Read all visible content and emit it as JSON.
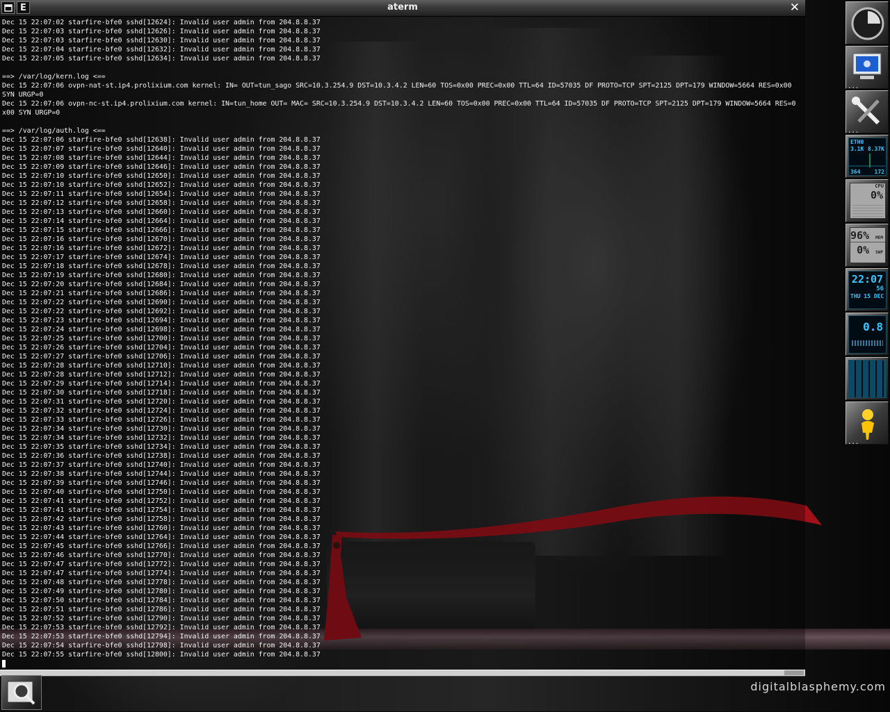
{
  "window": {
    "title": "aterm",
    "menu_button_label": "E",
    "close_symbol": "✕"
  },
  "terminal_lines": [
    "Dec 15 22:07:02 starfire-bfe0 sshd[12624]: Invalid user admin from 204.8.8.37",
    "Dec 15 22:07:03 starfire-bfe0 sshd[12626]: Invalid user admin from 204.8.8.37",
    "Dec 15 22:07:03 starfire-bfe0 sshd[12630]: Invalid user admin from 204.8.8.37",
    "Dec 15 22:07:04 starfire-bfe0 sshd[12632]: Invalid user admin from 204.8.8.37",
    "Dec 15 22:07:05 starfire-bfe0 sshd[12634]: Invalid user admin from 204.8.8.37",
    "",
    "==> /var/log/kern.log <==",
    "Dec 15 22:07:06 ovpn-nat-st.ip4.prolixium.com kernel: IN= OUT=tun_sago SRC=10.3.254.9 DST=10.3.4.2 LEN=60 TOS=0x00 PREC=0x00 TTL=64 ID=57035 DF PROTO=TCP SPT=2125 DPT=179 WINDOW=5664 RES=0x00",
    "SYN URGP=0",
    "Dec 15 22:07:06 ovpn-nc-st.ip4.prolixium.com kernel: IN=tun_home OUT= MAC= SRC=10.3.254.9 DST=10.3.4.2 LEN=60 TOS=0x00 PREC=0x00 TTL=64 ID=57035 DF PROTO=TCP SPT=2125 DPT=179 WINDOW=5664 RES=0",
    "x00 SYN URGP=0",
    "",
    "==> /var/log/auth.log <==",
    "Dec 15 22:07:06 starfire-bfe0 sshd[12638]: Invalid user admin from 204.8.8.37",
    "Dec 15 22:07:07 starfire-bfe0 sshd[12640]: Invalid user admin from 204.8.8.37",
    "Dec 15 22:07:08 starfire-bfe0 sshd[12644]: Invalid user admin from 204.8.8.37",
    "Dec 15 22:07:09 starfire-bfe0 sshd[12646]: Invalid user admin from 204.8.8.37",
    "Dec 15 22:07:10 starfire-bfe0 sshd[12650]: Invalid user admin from 204.8.8.37",
    "Dec 15 22:07:10 starfire-bfe0 sshd[12652]: Invalid user admin from 204.8.8.37",
    "Dec 15 22:07:11 starfire-bfe0 sshd[12654]: Invalid user admin from 204.8.8.37",
    "Dec 15 22:07:12 starfire-bfe0 sshd[12658]: Invalid user admin from 204.8.8.37",
    "Dec 15 22:07:13 starfire-bfe0 sshd[12660]: Invalid user admin from 204.8.8.37",
    "Dec 15 22:07:14 starfire-bfe0 sshd[12664]: Invalid user admin from 204.8.8.37",
    "Dec 15 22:07:15 starfire-bfe0 sshd[12666]: Invalid user admin from 204.8.8.37",
    "Dec 15 22:07:16 starfire-bfe0 sshd[12670]: Invalid user admin from 204.8.8.37",
    "Dec 15 22:07:16 starfire-bfe0 sshd[12672]: Invalid user admin from 204.8.8.37",
    "Dec 15 22:07:17 starfire-bfe0 sshd[12674]: Invalid user admin from 204.8.8.37",
    "Dec 15 22:07:18 starfire-bfe0 sshd[12678]: Invalid user admin from 204.8.8.37",
    "Dec 15 22:07:19 starfire-bfe0 sshd[12680]: Invalid user admin from 204.8.8.37",
    "Dec 15 22:07:20 starfire-bfe0 sshd[12684]: Invalid user admin from 204.8.8.37",
    "Dec 15 22:07:21 starfire-bfe0 sshd[12686]: Invalid user admin from 204.8.8.37",
    "Dec 15 22:07:22 starfire-bfe0 sshd[12690]: Invalid user admin from 204.8.8.37",
    "Dec 15 22:07:22 starfire-bfe0 sshd[12692]: Invalid user admin from 204.8.8.37",
    "Dec 15 22:07:23 starfire-bfe0 sshd[12694]: Invalid user admin from 204.8.8.37",
    "Dec 15 22:07:24 starfire-bfe0 sshd[12698]: Invalid user admin from 204.8.8.37",
    "Dec 15 22:07:25 starfire-bfe0 sshd[12700]: Invalid user admin from 204.8.8.37",
    "Dec 15 22:07:26 starfire-bfe0 sshd[12704]: Invalid user admin from 204.8.8.37",
    "Dec 15 22:07:27 starfire-bfe0 sshd[12706]: Invalid user admin from 204.8.8.37",
    "Dec 15 22:07:28 starfire-bfe0 sshd[12710]: Invalid user admin from 204.8.8.37",
    "Dec 15 22:07:28 starfire-bfe0 sshd[12712]: Invalid user admin from 204.8.8.37",
    "Dec 15 22:07:29 starfire-bfe0 sshd[12714]: Invalid user admin from 204.8.8.37",
    "Dec 15 22:07:30 starfire-bfe0 sshd[12718]: Invalid user admin from 204.8.8.37",
    "Dec 15 22:07:31 starfire-bfe0 sshd[12720]: Invalid user admin from 204.8.8.37",
    "Dec 15 22:07:32 starfire-bfe0 sshd[12724]: Invalid user admin from 204.8.8.37",
    "Dec 15 22:07:33 starfire-bfe0 sshd[12726]: Invalid user admin from 204.8.8.37",
    "Dec 15 22:07:34 starfire-bfe0 sshd[12730]: Invalid user admin from 204.8.8.37",
    "Dec 15 22:07:34 starfire-bfe0 sshd[12732]: Invalid user admin from 204.8.8.37",
    "Dec 15 22:07:35 starfire-bfe0 sshd[12734]: Invalid user admin from 204.8.8.37",
    "Dec 15 22:07:36 starfire-bfe0 sshd[12738]: Invalid user admin from 204.8.8.37",
    "Dec 15 22:07:37 starfire-bfe0 sshd[12740]: Invalid user admin from 204.8.8.37",
    "Dec 15 22:07:38 starfire-bfe0 sshd[12744]: Invalid user admin from 204.8.8.37",
    "Dec 15 22:07:39 starfire-bfe0 sshd[12746]: Invalid user admin from 204.8.8.37",
    "Dec 15 22:07:40 starfire-bfe0 sshd[12750]: Invalid user admin from 204.8.8.37",
    "Dec 15 22:07:41 starfire-bfe0 sshd[12752]: Invalid user admin from 204.8.8.37",
    "Dec 15 22:07:41 starfire-bfe0 sshd[12754]: Invalid user admin from 204.8.8.37",
    "Dec 15 22:07:42 starfire-bfe0 sshd[12758]: Invalid user admin from 204.8.8.37",
    "Dec 15 22:07:43 starfire-bfe0 sshd[12760]: Invalid user admin from 204.8.8.37",
    "Dec 15 22:07:44 starfire-bfe0 sshd[12764]: Invalid user admin from 204.8.8.37",
    "Dec 15 22:07:45 starfire-bfe0 sshd[12766]: Invalid user admin from 204.8.8.37",
    "Dec 15 22:07:46 starfire-bfe0 sshd[12770]: Invalid user admin from 204.8.8.37",
    "Dec 15 22:07:47 starfire-bfe0 sshd[12772]: Invalid user admin from 204.8.8.37",
    "Dec 15 22:07:47 starfire-bfe0 sshd[12774]: Invalid user admin from 204.8.8.37",
    "Dec 15 22:07:48 starfire-bfe0 sshd[12778]: Invalid user admin from 204.8.8.37",
    "Dec 15 22:07:49 starfire-bfe0 sshd[12780]: Invalid user admin from 204.8.8.37",
    "Dec 15 22:07:50 starfire-bfe0 sshd[12784]: Invalid user admin from 204.8.8.37",
    "Dec 15 22:07:51 starfire-bfe0 sshd[12786]: Invalid user admin from 204.8.8.37",
    "Dec 15 22:07:52 starfire-bfe0 sshd[12790]: Invalid user admin from 204.8.8.37",
    "Dec 15 22:07:53 starfire-bfe0 sshd[12792]: Invalid user admin from 204.8.8.37",
    "Dec 15 22:07:53 starfire-bfe0 sshd[12794]: Invalid user admin from 204.8.8.37",
    "Dec 15 22:07:54 starfire-bfe0 sshd[12798]: Invalid user admin from 204.8.8.37",
    "Dec 15 22:07:55 starfire-bfe0 sshd[12800]: Invalid user admin from 204.8.8.37"
  ],
  "dock": {
    "net_monitor": {
      "iface": "ETH0",
      "rx": "3.1K",
      "tx": "8.37K",
      "rx_total": "364",
      "tx_total": "172"
    },
    "cpu_monitor": {
      "value": "0%",
      "tag": "CPU"
    },
    "mem_monitor": {
      "mem": "96%",
      "swap": "0%",
      "mem_tag": "MEM",
      "swap_tag": "SWP"
    },
    "clock": {
      "time": "22:07",
      "seconds": "56",
      "day": "THU",
      "date": "15",
      "month": "DEC"
    },
    "load_monitor": {
      "value": "0.8"
    },
    "ellipsis": "..."
  },
  "wallpaper": {
    "watermark": "digitalblasphemy.com"
  },
  "colors": {
    "accent_red": "#c0111c",
    "terminal_text": "#f2f2f2",
    "lcd_cyan": "#39c6ff"
  }
}
